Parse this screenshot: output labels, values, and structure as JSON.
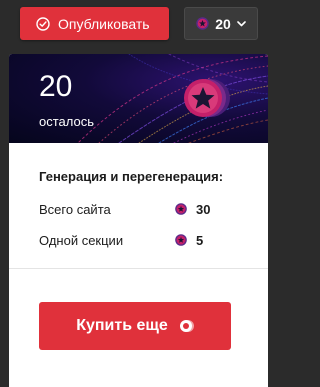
{
  "topbar": {
    "publish_label": "Опубликовать",
    "credits_count": "20"
  },
  "card": {
    "count": "20",
    "count_caption": "осталось",
    "section_title": "Генерация и перегенерация:",
    "rows": [
      {
        "label": "Всего сайта",
        "value": "30"
      },
      {
        "label": "Одной секции",
        "value": "5"
      }
    ],
    "buy_label": "Купить еще"
  },
  "icons": {
    "publish": "check-circle-icon",
    "coin": "star-coin-icon",
    "dropdown": "chevron-down-icon"
  },
  "colors": {
    "accent_red": "#e0313b",
    "coin_pink": "#c4206a",
    "coin_purple": "#5b2a8a"
  }
}
